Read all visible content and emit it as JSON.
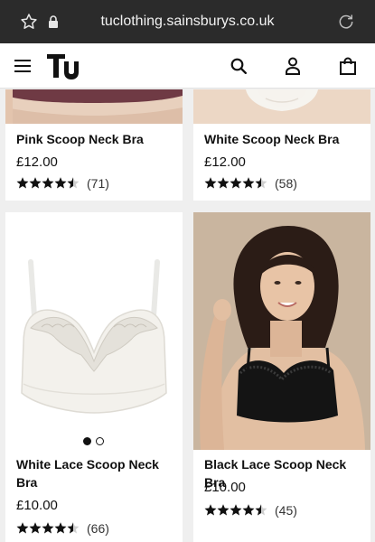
{
  "browser": {
    "url": "tuclothing.sainsburys.co.uk"
  },
  "header": {
    "logo_text": "Tu"
  },
  "products": [
    {
      "name": "Pink Scoop Neck Bra",
      "price": "£12.00",
      "rating_count": "(71)",
      "rating": 4.5
    },
    {
      "name": "White Scoop Neck Bra",
      "price": "£12.00",
      "rating_count": "(58)",
      "rating": 4.5
    },
    {
      "name": "White Lace Scoop Neck Bra",
      "price": "£10.00",
      "rating_count": "(66)",
      "rating": 4.5
    },
    {
      "name": "Black Lace Scoop Neck Bra",
      "price": "£10.00",
      "rating_count": "(45)",
      "rating": 4.5
    }
  ],
  "colors": {
    "browser_bar": "#2b2b2b",
    "page_bg": "#efefef",
    "text": "#111111"
  }
}
